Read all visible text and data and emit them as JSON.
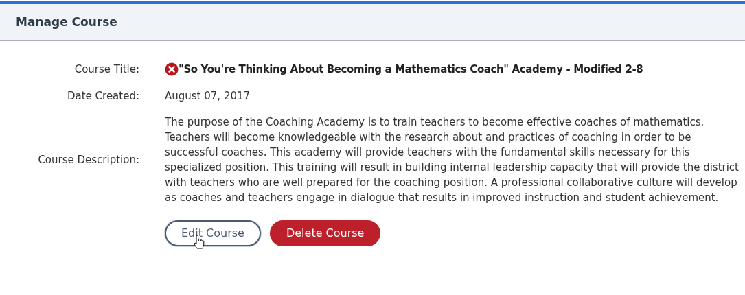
{
  "header": {
    "title": "Manage Course"
  },
  "fields": [
    {
      "kind": "title",
      "label": "Course Title:",
      "value": "\"So You're Thinking About Becoming a Mathematics Coach\" Academy - Modified 2-8",
      "error": true
    },
    {
      "kind": "text",
      "label": "Date Created:",
      "value": "August 07, 2017"
    },
    {
      "kind": "text",
      "label": "Course Description:",
      "value": "The purpose of the Coaching Academy is to train teachers to become effective coaches of mathematics. Teachers will become knowledgeable with the research about and practices of coaching in order to be successful coaches. This academy will provide teachers with the fundamental skills necessary for this specialized position. This training will result in building internal leadership capacity that will provide the district with teachers who are well prepared for the coaching position. A professional collaborative culture will develop as coaches and teachers engage in dialogue that results in improved instruction and student achievement."
    }
  ],
  "buttons": [
    {
      "kind": "outline",
      "label": "Edit Course",
      "hovered": true
    },
    {
      "kind": "danger",
      "label": "Delete Course",
      "hovered": false
    }
  ]
}
